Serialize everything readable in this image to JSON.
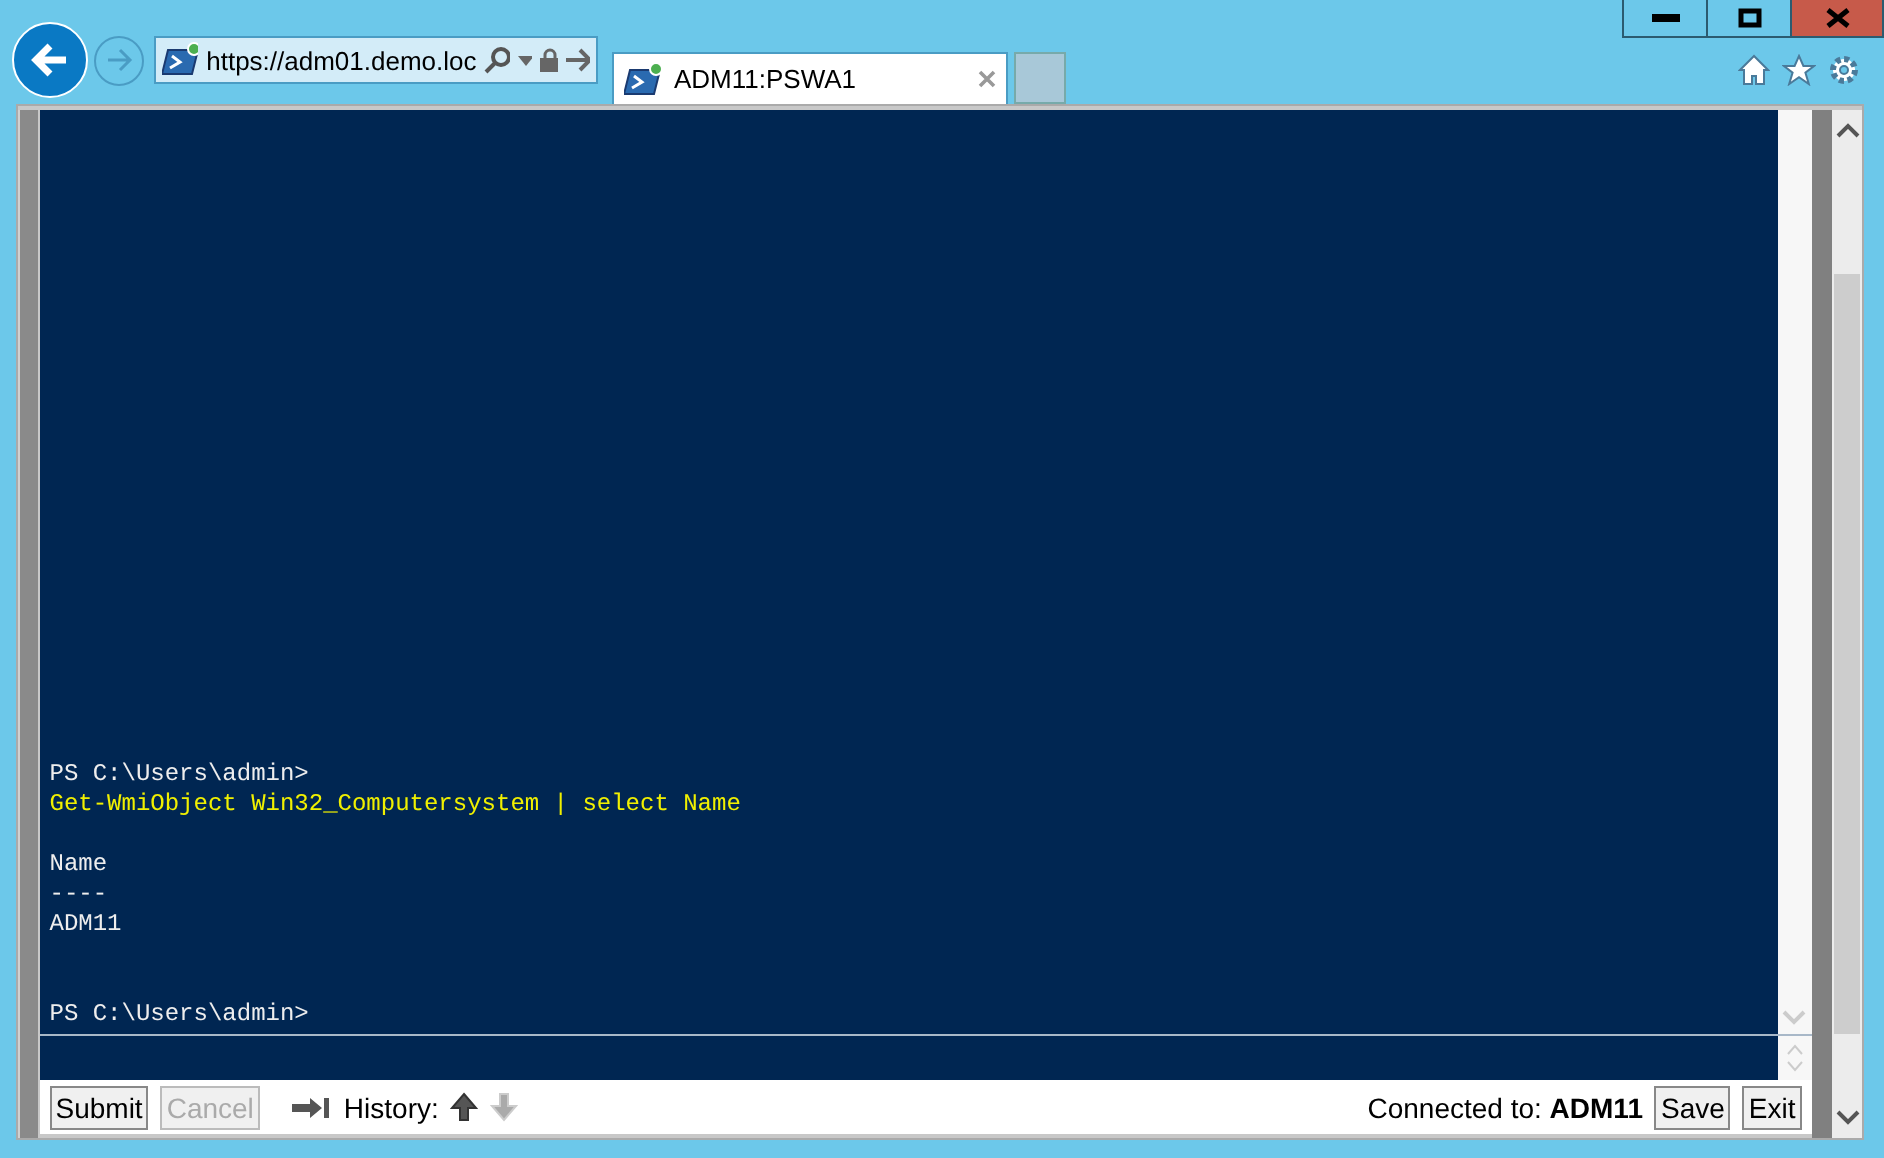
{
  "browser": {
    "address": "https://adm01.demo.loc",
    "tabs": [
      {
        "label": "ADM11:PSWA1",
        "selected": true
      }
    ]
  },
  "console": {
    "lines": [
      {
        "kind": "prompt",
        "text": "PS C:\\Users\\admin>"
      },
      {
        "kind": "command",
        "text": "Get-WmiObject Win32_Computersystem | select Name"
      },
      {
        "kind": "blank"
      },
      {
        "kind": "output",
        "text": "Name"
      },
      {
        "kind": "output",
        "text": "----"
      },
      {
        "kind": "output",
        "text": "ADM11"
      },
      {
        "kind": "blank"
      },
      {
        "kind": "blank"
      },
      {
        "kind": "prompt",
        "text": "PS C:\\Users\\admin>"
      }
    ]
  },
  "toolbar": {
    "submit": {
      "label": "Submit",
      "disabled": false
    },
    "cancel": {
      "label": "Cancel",
      "disabled": true
    },
    "history_label": "History:",
    "history_up": {
      "disabled": false
    },
    "history_down": {
      "disabled": true
    },
    "status": "Connected to: **ADM11**",
    "save": "Save",
    "exit": "Exit"
  }
}
